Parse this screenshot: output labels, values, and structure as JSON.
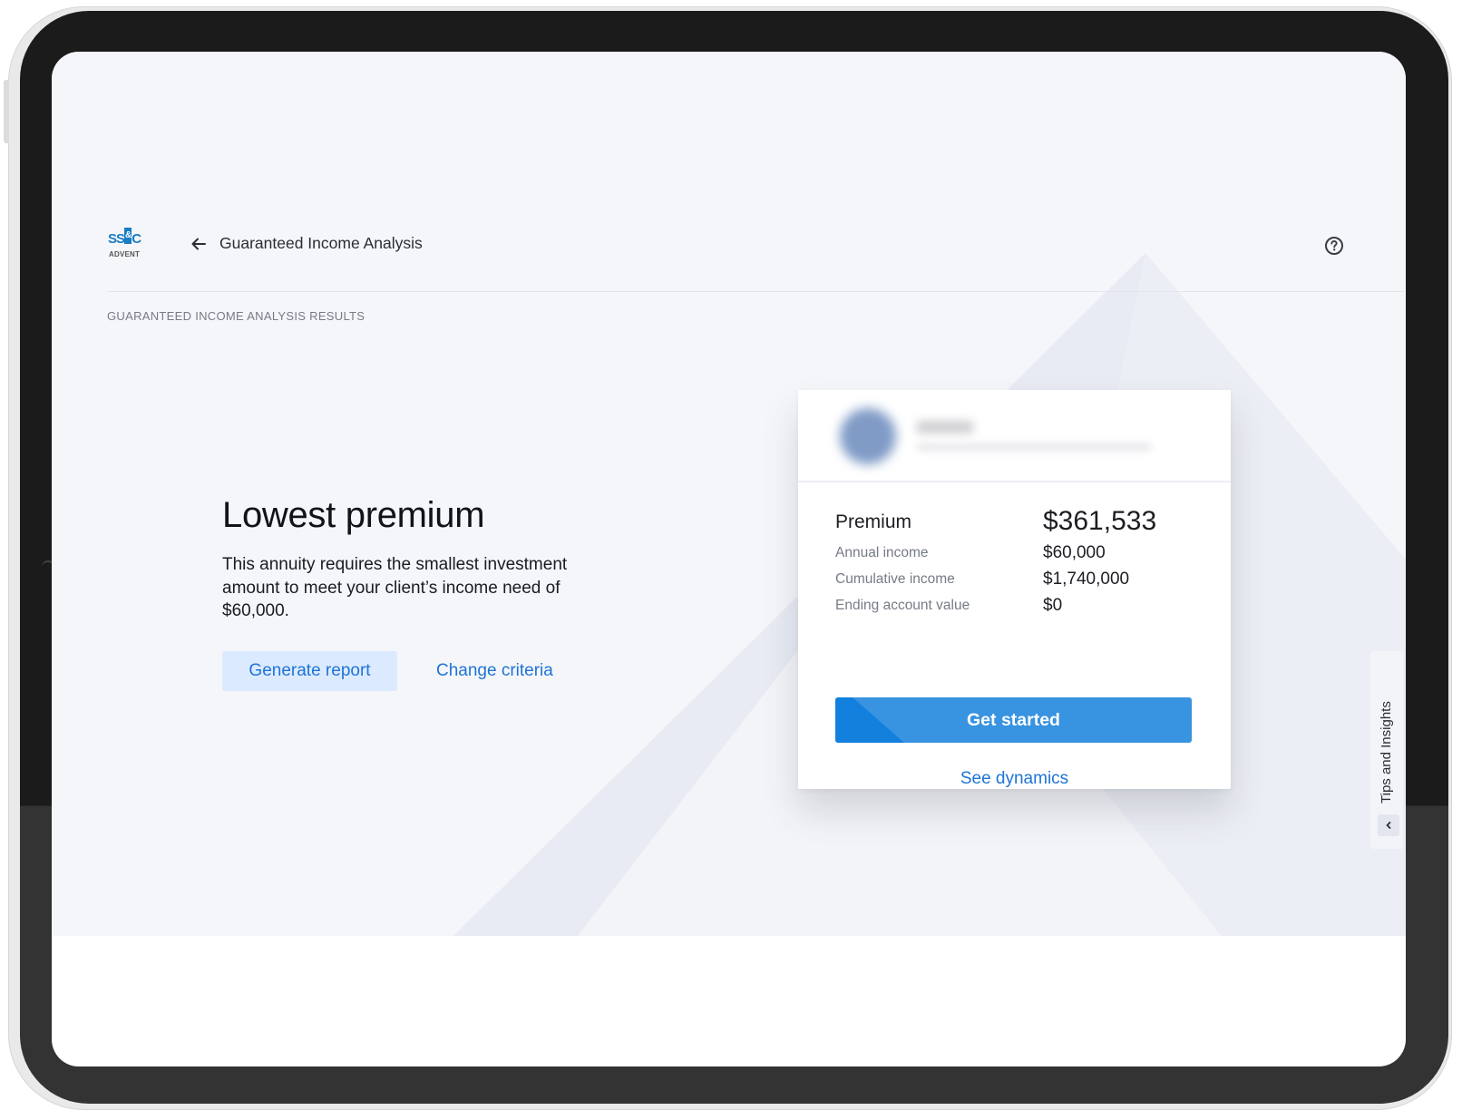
{
  "app": {
    "logo": {
      "brand": "SS&C",
      "brand_prefix": "SS",
      "brand_amp": "&",
      "brand_suffix": "C",
      "sub": "ADVENT"
    },
    "header": {
      "title": "Guaranteed Income Analysis",
      "back_icon": "arrow-left-icon",
      "help_icon": "question-circle-icon"
    },
    "section_label": "GUARANTEED INCOME ANALYSIS RESULTS"
  },
  "result": {
    "title": "Lowest premium",
    "description": "This annuity requires the smallest investment amount to meet your client’s income need of $60,000.",
    "actions": {
      "generate_report": "Generate report",
      "change_criteria": "Change criteria"
    }
  },
  "card": {
    "provider": {
      "name": "[blurred]",
      "subtitle": "[blurred]"
    },
    "premium": {
      "label": "Premium",
      "value": "$361,533"
    },
    "rows": [
      {
        "label": "Annual income",
        "value": "$60,000"
      },
      {
        "label": "Cumulative income",
        "value": "$1,740,000"
      },
      {
        "label": "Ending account value",
        "value": "$0"
      }
    ],
    "primary_action": "Get started",
    "secondary_action": "See dynamics"
  },
  "tips_panel": {
    "label": "Tips and Insights",
    "toggle_icon": "chevron-left-icon"
  },
  "colors": {
    "accent": "#1e74d6",
    "primary_button": "#3893e0",
    "primary_button_dark": "#1280dc",
    "secondary_button_bg": "#dceaff",
    "page_bg": "#f5f6fa",
    "shape": "#e8ebf3"
  }
}
